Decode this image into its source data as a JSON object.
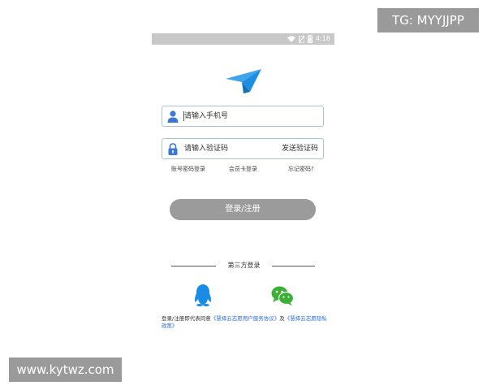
{
  "watermarks": {
    "top": "TG: MYYJJPP",
    "bottom": "www.kytwz.com"
  },
  "status_bar": {
    "time": "4:18",
    "icons": [
      "wifi-icon",
      "no-sim-icon",
      "battery-icon"
    ]
  },
  "logo": {
    "icon": "paper-plane-icon",
    "color": "#1e8fe0"
  },
  "phone_field": {
    "icon": "user-icon",
    "placeholder": "请输入手机号"
  },
  "code_field": {
    "icon": "lock-icon",
    "placeholder": "请输入验证码",
    "action_label": "发送验证码"
  },
  "links": {
    "password_login": "账号密码登录",
    "card_login": "会员卡登录",
    "forgot_password": "忘记密码?"
  },
  "login_button": {
    "label": "登录/注册",
    "color": "#9b9b9b"
  },
  "third_party": {
    "title": "第三方登录",
    "providers": [
      {
        "name": "qq-icon",
        "color": "#1a8ce6"
      },
      {
        "name": "wechat-icon",
        "color": "#3cb034"
      }
    ]
  },
  "agreement": {
    "prefix": "登录/注册即代表同意",
    "link1": "《慧择云志愿用户服务协议》",
    "and": "及",
    "link2": "《慧择云志愿隐私政策》"
  },
  "colors": {
    "accent_blue": "#2a6fd6",
    "field_border": "#a9c3d6",
    "status_bar": "#c8c8c8"
  }
}
